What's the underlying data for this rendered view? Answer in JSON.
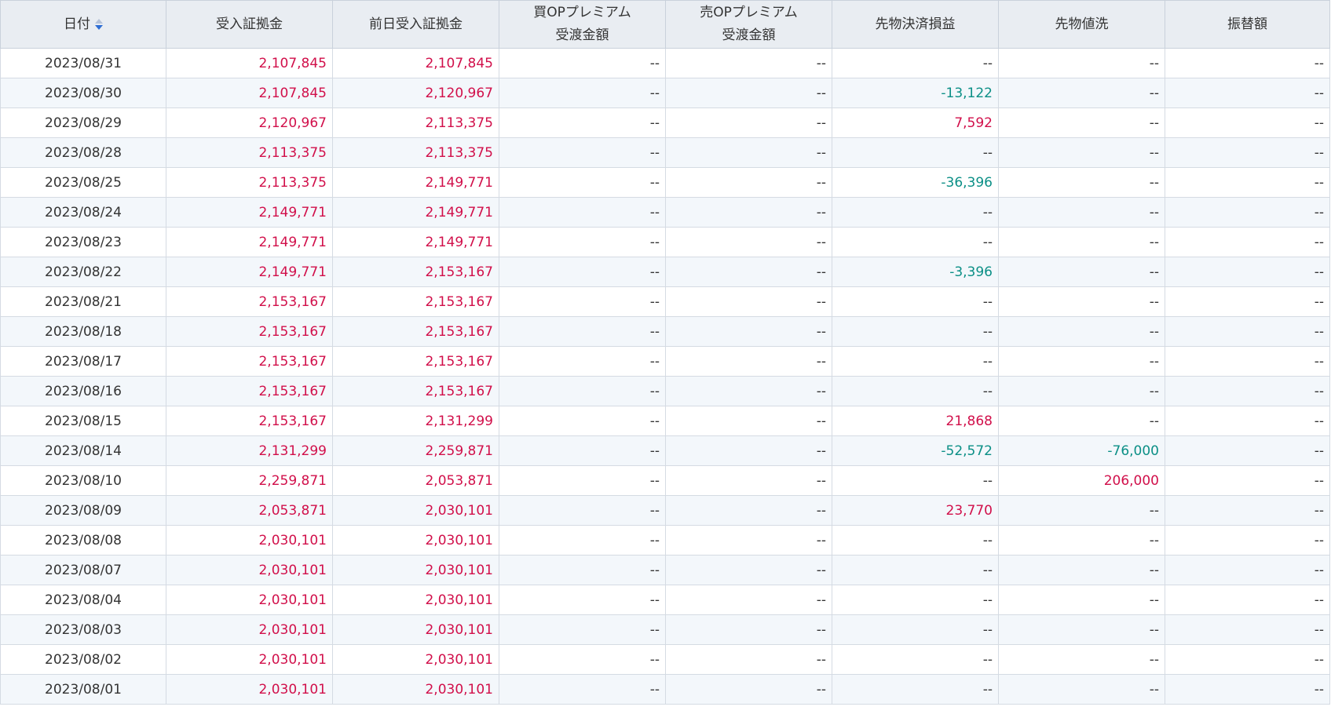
{
  "table": {
    "headers": [
      {
        "key": "date",
        "lines": [
          "日付"
        ],
        "sortable": true
      },
      {
        "key": "margin",
        "lines": [
          "受入証拠金"
        ]
      },
      {
        "key": "prev_margin",
        "lines": [
          "前日受入証拠金"
        ]
      },
      {
        "key": "buy_op",
        "lines": [
          "買OPプレミアム",
          "受渡金額"
        ]
      },
      {
        "key": "sell_op",
        "lines": [
          "売OPプレミアム",
          "受渡金額"
        ]
      },
      {
        "key": "futures_pl",
        "lines": [
          "先物決済損益"
        ]
      },
      {
        "key": "futures_mtm",
        "lines": [
          "先物値洗"
        ]
      },
      {
        "key": "transfer",
        "lines": [
          "振替額"
        ]
      }
    ],
    "sort_icon": "sort-desc-icon",
    "rows": [
      [
        "2023/08/31",
        "2,107,845",
        "2,107,845",
        "--",
        "--",
        "--",
        "--",
        "--"
      ],
      [
        "2023/08/30",
        "2,107,845",
        "2,120,967",
        "--",
        "--",
        "-13,122",
        "--",
        "--"
      ],
      [
        "2023/08/29",
        "2,120,967",
        "2,113,375",
        "--",
        "--",
        "7,592",
        "--",
        "--"
      ],
      [
        "2023/08/28",
        "2,113,375",
        "2,113,375",
        "--",
        "--",
        "--",
        "--",
        "--"
      ],
      [
        "2023/08/25",
        "2,113,375",
        "2,149,771",
        "--",
        "--",
        "-36,396",
        "--",
        "--"
      ],
      [
        "2023/08/24",
        "2,149,771",
        "2,149,771",
        "--",
        "--",
        "--",
        "--",
        "--"
      ],
      [
        "2023/08/23",
        "2,149,771",
        "2,149,771",
        "--",
        "--",
        "--",
        "--",
        "--"
      ],
      [
        "2023/08/22",
        "2,149,771",
        "2,153,167",
        "--",
        "--",
        "-3,396",
        "--",
        "--"
      ],
      [
        "2023/08/21",
        "2,153,167",
        "2,153,167",
        "--",
        "--",
        "--",
        "--",
        "--"
      ],
      [
        "2023/08/18",
        "2,153,167",
        "2,153,167",
        "--",
        "--",
        "--",
        "--",
        "--"
      ],
      [
        "2023/08/17",
        "2,153,167",
        "2,153,167",
        "--",
        "--",
        "--",
        "--",
        "--"
      ],
      [
        "2023/08/16",
        "2,153,167",
        "2,153,167",
        "--",
        "--",
        "--",
        "--",
        "--"
      ],
      [
        "2023/08/15",
        "2,153,167",
        "2,131,299",
        "--",
        "--",
        "21,868",
        "--",
        "--"
      ],
      [
        "2023/08/14",
        "2,131,299",
        "2,259,871",
        "--",
        "--",
        "-52,572",
        "-76,000",
        "--"
      ],
      [
        "2023/08/10",
        "2,259,871",
        "2,053,871",
        "--",
        "--",
        "--",
        "206,000",
        "--"
      ],
      [
        "2023/08/09",
        "2,053,871",
        "2,030,101",
        "--",
        "--",
        "23,770",
        "--",
        "--"
      ],
      [
        "2023/08/08",
        "2,030,101",
        "2,030,101",
        "--",
        "--",
        "--",
        "--",
        "--"
      ],
      [
        "2023/08/07",
        "2,030,101",
        "2,030,101",
        "--",
        "--",
        "--",
        "--",
        "--"
      ],
      [
        "2023/08/04",
        "2,030,101",
        "2,030,101",
        "--",
        "--",
        "--",
        "--",
        "--"
      ],
      [
        "2023/08/03",
        "2,030,101",
        "2,030,101",
        "--",
        "--",
        "--",
        "--",
        "--"
      ],
      [
        "2023/08/02",
        "2,030,101",
        "2,030,101",
        "--",
        "--",
        "--",
        "--",
        "--"
      ],
      [
        "2023/08/01",
        "2,030,101",
        "2,030,101",
        "--",
        "--",
        "--",
        "--",
        "--"
      ]
    ]
  },
  "colors": {
    "positive": "#d10f4a",
    "negative": "#0b8f86",
    "neutral": "#333333",
    "header_bg": "#e9edf2",
    "stripe_bg": "#f3f7fb",
    "sort_active": "#2e6ed4"
  }
}
